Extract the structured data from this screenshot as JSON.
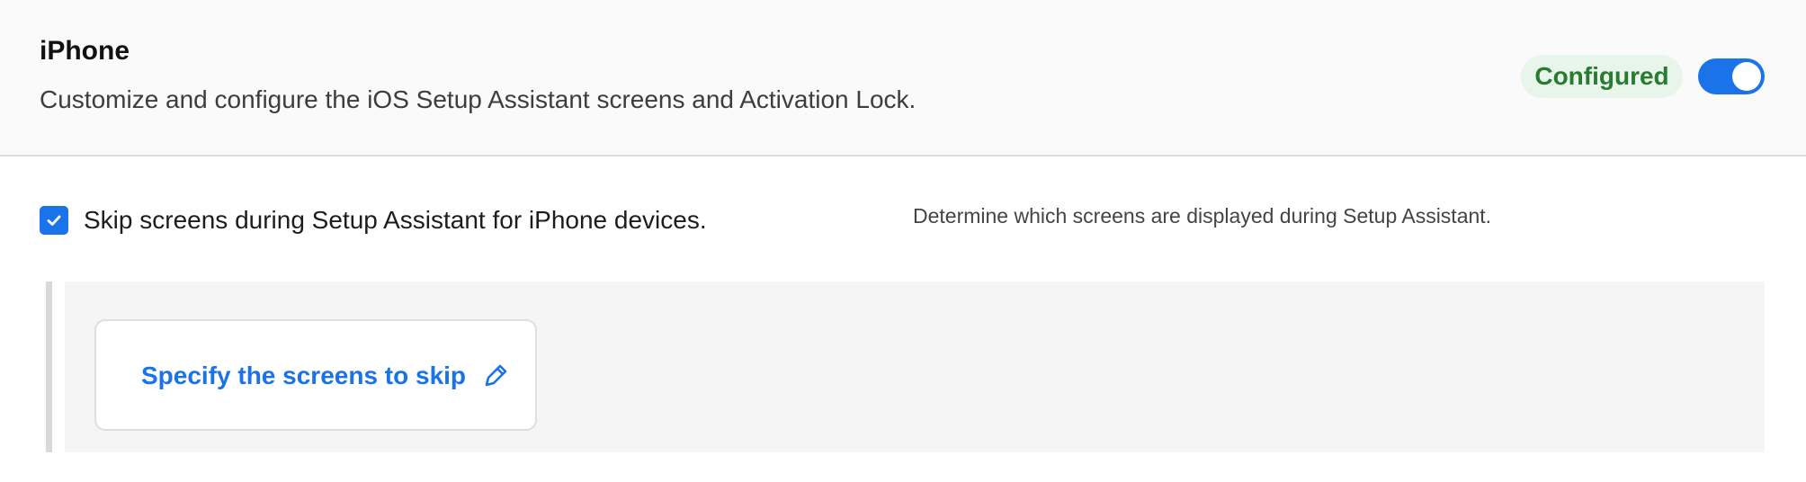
{
  "header": {
    "title": "iPhone",
    "description": "Customize and configure the iOS Setup Assistant screens and Activation Lock.",
    "status_badge": "Configured",
    "toggle_on": true,
    "colors": {
      "accent": "#1a73e8",
      "badge_text": "#2a7a32",
      "badge_bg": "#e8f5ea"
    }
  },
  "options": {
    "skip_checkbox_checked": true,
    "skip_checkbox_label": "Skip screens during Setup Assistant for iPhone devices.",
    "helper_text": "Determine which screens are displayed during Setup Assistant."
  },
  "panel": {
    "specify_link_label": "Specify the screens to skip",
    "icons": {
      "checkbox": "check-icon",
      "edit": "pencil-icon"
    }
  }
}
